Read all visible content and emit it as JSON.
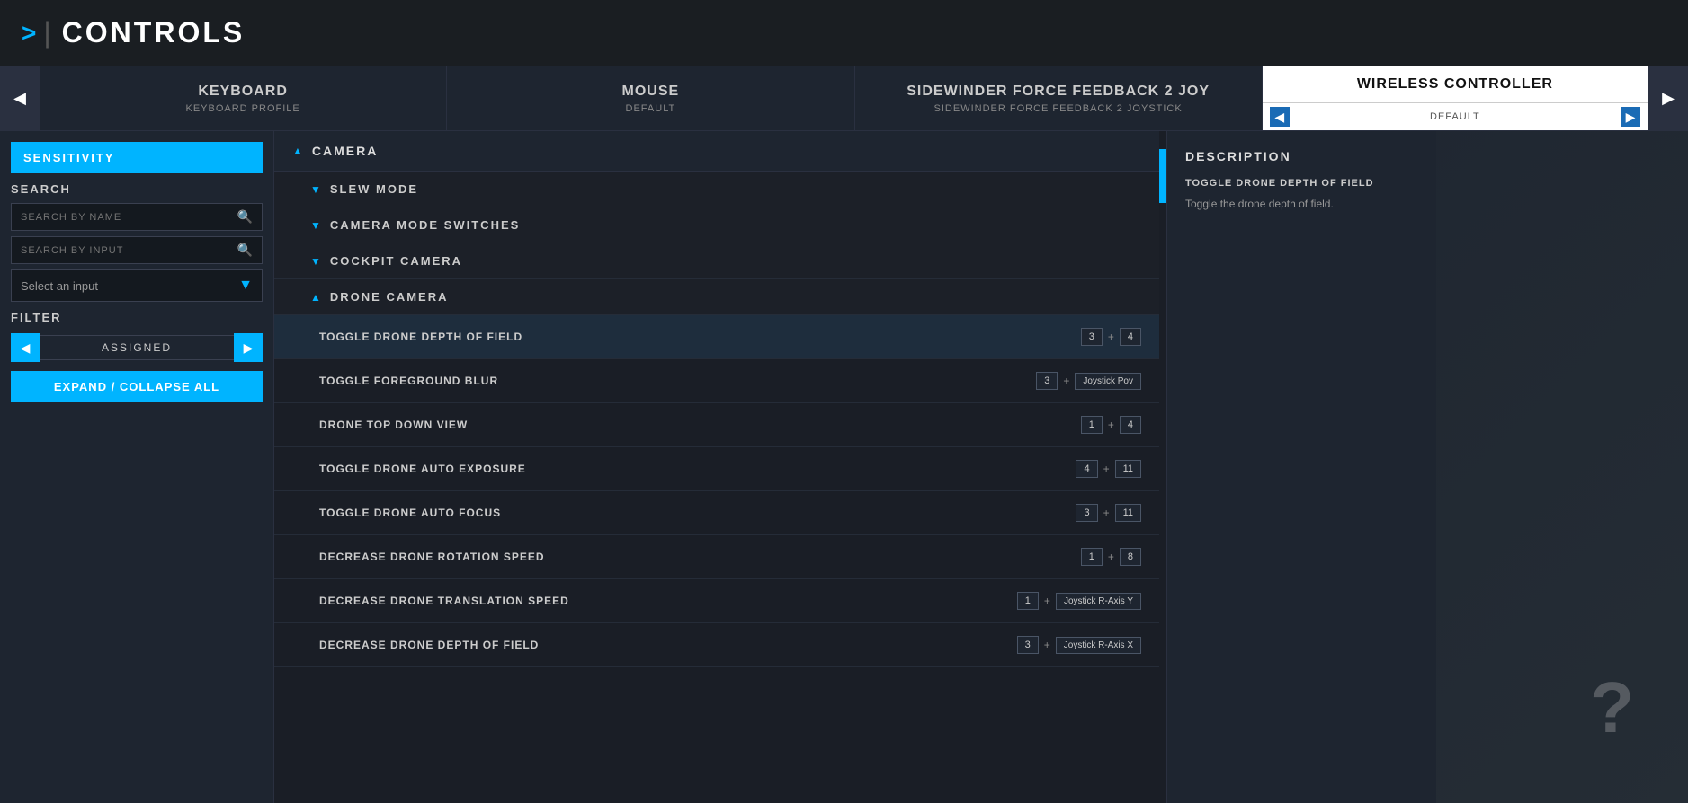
{
  "header": {
    "icon": ">",
    "separator": "|",
    "title": "CONTROLS"
  },
  "tabs": [
    {
      "name": "KEYBOARD",
      "sub": "KEYBOARD PROFILE",
      "active": false
    },
    {
      "name": "MOUSE",
      "sub": "DEFAULT",
      "active": false
    },
    {
      "name": "SIDEWINDER FORCE FEEDBACK 2 JOY",
      "sub": "SIDEWINDER FORCE FEEDBACK 2 JOYSTICK",
      "active": false
    }
  ],
  "active_tab": {
    "name": "WIRELESS CONTROLLER",
    "sub": "DEFAULT"
  },
  "sidebar": {
    "sensitivity_label": "SENSITIVITY",
    "search_label": "SEARCH",
    "search_by_name_placeholder": "SEARCH BY NAME",
    "search_by_input_placeholder": "SEARCH BY INPUT",
    "select_input_label": "Select an input",
    "filter_label": "FILTER",
    "filter_value": "ASSIGNED",
    "expand_collapse_label": "EXPAND / COLLAPSE ALL"
  },
  "categories": [
    {
      "name": "CAMERA",
      "expanded": true,
      "subcategories": [
        {
          "name": "SLEW MODE",
          "expanded": false,
          "controls": []
        },
        {
          "name": "CAMERA MODE SWITCHES",
          "expanded": false,
          "controls": []
        },
        {
          "name": "COCKPIT CAMERA",
          "expanded": false,
          "controls": []
        },
        {
          "name": "DRONE CAMERA",
          "expanded": true,
          "controls": [
            {
              "name": "TOGGLE DRONE DEPTH OF FIELD",
              "binding": [
                {
                  "key": "3"
                },
                {
                  "plus": true
                },
                {
                  "key": "4"
                }
              ],
              "selected": true
            },
            {
              "name": "TOGGLE FOREGROUND BLUR",
              "binding": [
                {
                  "key": "3"
                },
                {
                  "plus": true
                },
                {
                  "key": "Joystick Pov",
                  "wide": true
                }
              ]
            },
            {
              "name": "DRONE TOP DOWN VIEW",
              "binding": [
                {
                  "key": "1"
                },
                {
                  "plus": true
                },
                {
                  "key": "4"
                }
              ]
            },
            {
              "name": "TOGGLE DRONE AUTO EXPOSURE",
              "binding": [
                {
                  "key": "4"
                },
                {
                  "plus": true
                },
                {
                  "key": "11"
                }
              ]
            },
            {
              "name": "TOGGLE DRONE AUTO FOCUS",
              "binding": [
                {
                  "key": "3"
                },
                {
                  "plus": true
                },
                {
                  "key": "11"
                }
              ]
            },
            {
              "name": "DECREASE DRONE ROTATION SPEED",
              "binding": [
                {
                  "key": "1"
                },
                {
                  "plus": true
                },
                {
                  "key": "8"
                }
              ]
            },
            {
              "name": "DECREASE DRONE TRANSLATION SPEED",
              "binding": [
                {
                  "key": "1"
                },
                {
                  "plus": true
                },
                {
                  "key": "Joystick R-Axis Y",
                  "wide": true
                }
              ]
            },
            {
              "name": "DECREASE DRONE DEPTH OF FIELD",
              "binding": [
                {
                  "key": "3"
                },
                {
                  "plus": true
                },
                {
                  "key": "Joystick R-Axis X",
                  "wide": true
                }
              ]
            }
          ]
        }
      ]
    }
  ],
  "description": {
    "title": "DESCRIPTION",
    "item_title": "TOGGLE DRONE DEPTH OF FIELD",
    "item_text": "Toggle the drone depth of field."
  }
}
